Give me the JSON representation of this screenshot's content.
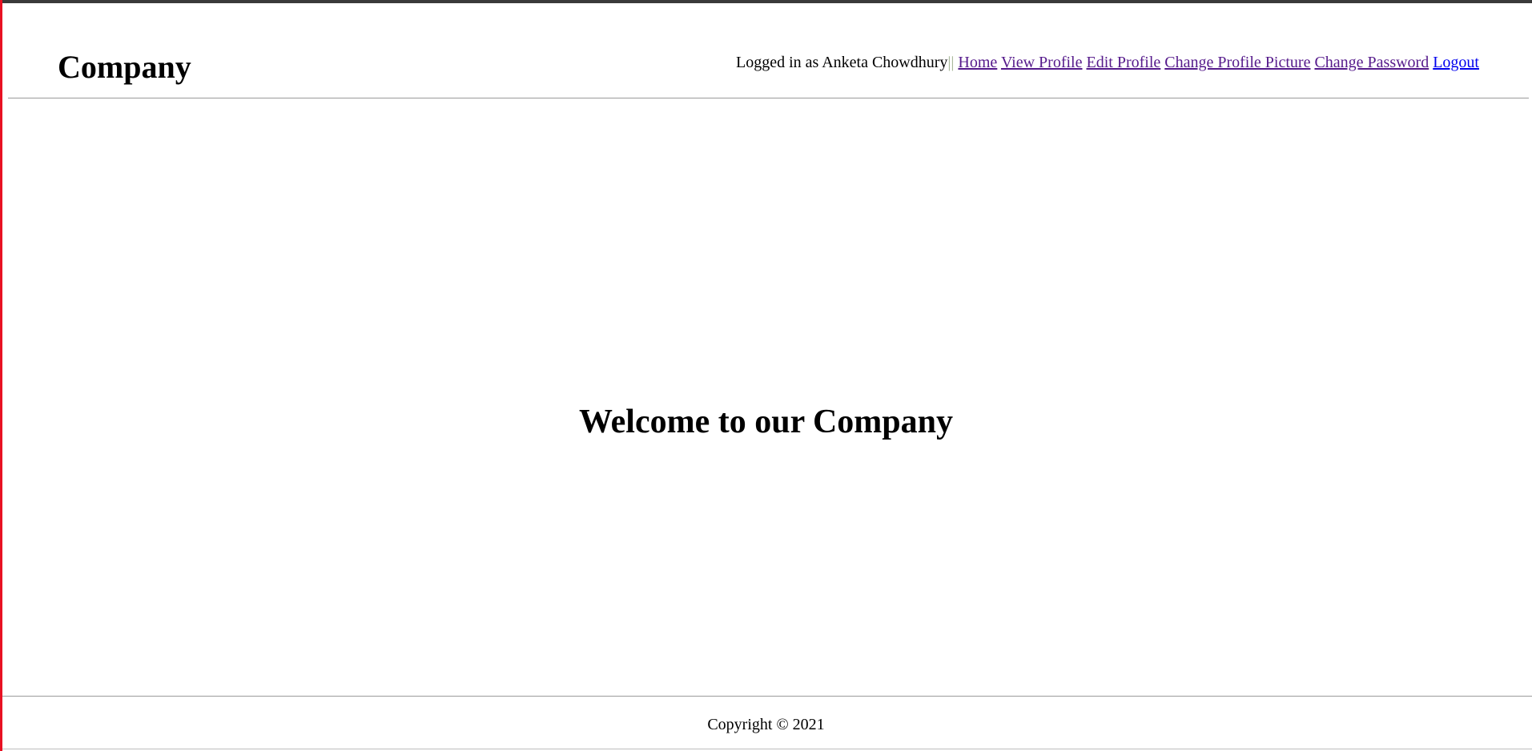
{
  "header": {
    "brand": "Company",
    "logged_in_text": "Logged in as Anketa Chowdhury",
    "separator": "||",
    "links": [
      {
        "label": "Home"
      },
      {
        "label": "View Profile"
      },
      {
        "label": "Edit Profile"
      },
      {
        "label": "Change Profile Picture"
      },
      {
        "label": "Change Password"
      },
      {
        "label": "Logout"
      }
    ]
  },
  "main": {
    "welcome": "Welcome to our Company"
  },
  "footer": {
    "copyright": "Copyright © 2021"
  },
  "colors": {
    "visited_link": "#551a8b",
    "unvisited_link": "#0000ee",
    "separator": "#a0b090"
  }
}
